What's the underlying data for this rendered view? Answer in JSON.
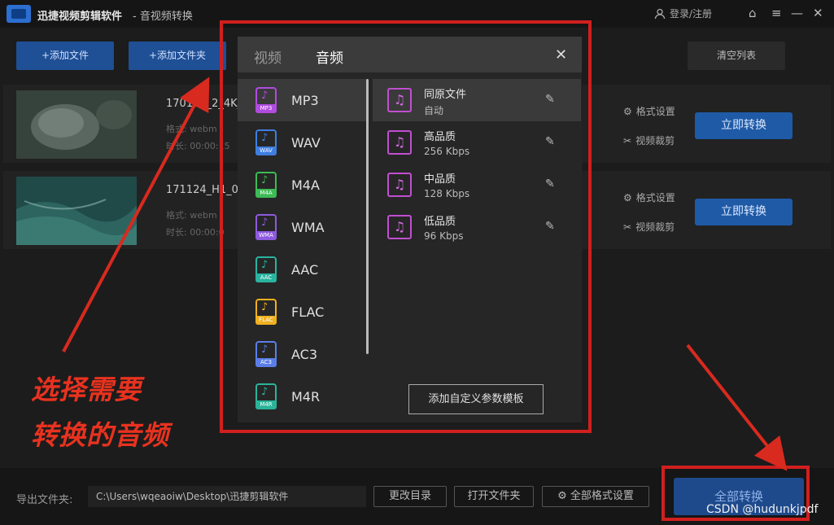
{
  "window": {
    "app_name": "迅捷视频剪辑软件",
    "subtitle": "- 音视频转换",
    "login": "登录/注册"
  },
  "toolbar": {
    "add_file": "+添加文件",
    "add_folder": "+添加文件夹",
    "clear_list": "清空列表"
  },
  "files": [
    {
      "name": "170105_2_4K_",
      "format": "格式: webm",
      "duration": "时长: 00:00:15",
      "format_settings": "格式设置",
      "crop": "视频裁剪",
      "convert": "立即转换"
    },
    {
      "name": "171124_H1_0",
      "format": "格式: webm",
      "duration": "时长: 00:00:0",
      "format_settings": "格式设置",
      "crop": "视频裁剪",
      "convert": "立即转换"
    }
  ],
  "dropdown": {
    "tabs": [
      "视频",
      "音频"
    ],
    "active_tab": "音频",
    "formats": [
      {
        "label": "MP3",
        "color": "#b14ce0"
      },
      {
        "label": "WAV",
        "color": "#3f7ee0"
      },
      {
        "label": "M4A",
        "color": "#3dbb55"
      },
      {
        "label": "WMA",
        "color": "#8e5ae0"
      },
      {
        "label": "AAC",
        "color": "#2ab4a0"
      },
      {
        "label": "FLAC",
        "color": "#f0b020"
      },
      {
        "label": "AC3",
        "color": "#5a7ee8"
      },
      {
        "label": "M4R",
        "color": "#2ab49a"
      }
    ],
    "selected_format": "MP3",
    "qualities": [
      {
        "name": "同原文件",
        "rate": "自动"
      },
      {
        "name": "高品质",
        "rate": "256 Kbps"
      },
      {
        "name": "中品质",
        "rate": "128 Kbps"
      },
      {
        "name": "低品质",
        "rate": "96 Kbps"
      }
    ],
    "add_template": "添加自定义参数模板"
  },
  "bottom": {
    "export_label": "导出文件夹:",
    "path": "C:\\Users\\wqeaoiw\\Desktop\\迅捷剪辑软件",
    "change_dir": "更改目录",
    "open_folder": "打开文件夹",
    "all_format_settings": "全部格式设置",
    "convert_all": "全部转换"
  },
  "annotation": {
    "line1": "选择需要",
    "line2": "转换的音频",
    "color": "#e8321f"
  },
  "watermark": "CSDN @hudunkjpdf"
}
